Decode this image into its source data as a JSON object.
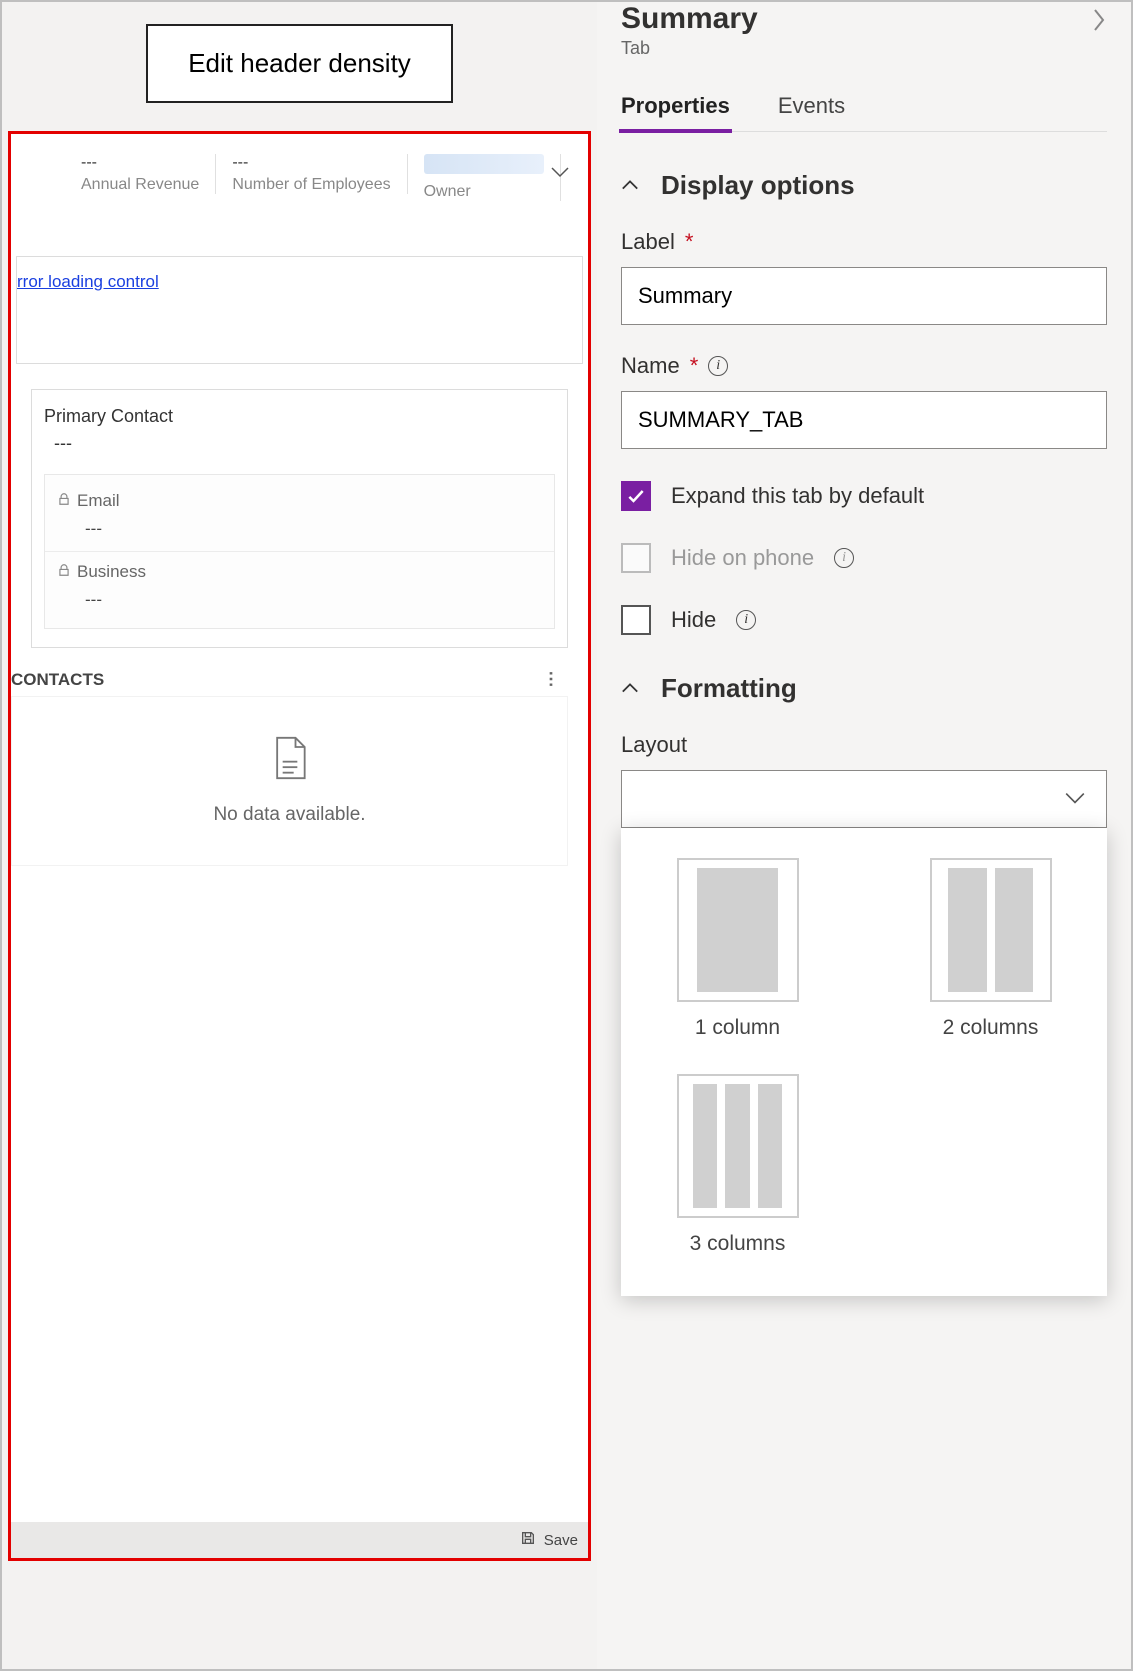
{
  "callout": {
    "button": "Edit header density"
  },
  "form": {
    "header_fields": [
      {
        "value": "---",
        "label": "Annual Revenue"
      },
      {
        "value": "---",
        "label": "Number of Employees"
      },
      {
        "value": "",
        "label": "Owner"
      }
    ],
    "error_text": "rror loading control",
    "primary_contact": {
      "label": "Primary Contact",
      "value": "---"
    },
    "email": {
      "label": "Email",
      "value": "---"
    },
    "business": {
      "label": "Business",
      "value": "---"
    },
    "contacts_heading": "CONTACTS",
    "empty_text": "No data available.",
    "save_label": "Save"
  },
  "panel": {
    "title": "Summary",
    "subtitle": "Tab",
    "tabs": {
      "properties": "Properties",
      "events": "Events"
    },
    "display_section": "Display options",
    "label_field": {
      "label": "Label",
      "value": "Summary"
    },
    "name_field": {
      "label": "Name",
      "value": "SUMMARY_TAB"
    },
    "expand_default": "Expand this tab by default",
    "hide_phone": "Hide on phone",
    "hide": "Hide",
    "formatting_section": "Formatting",
    "layout_label": "Layout",
    "layout_options": {
      "c1": "1 column",
      "c2": "2 columns",
      "c3": "3 columns"
    }
  }
}
